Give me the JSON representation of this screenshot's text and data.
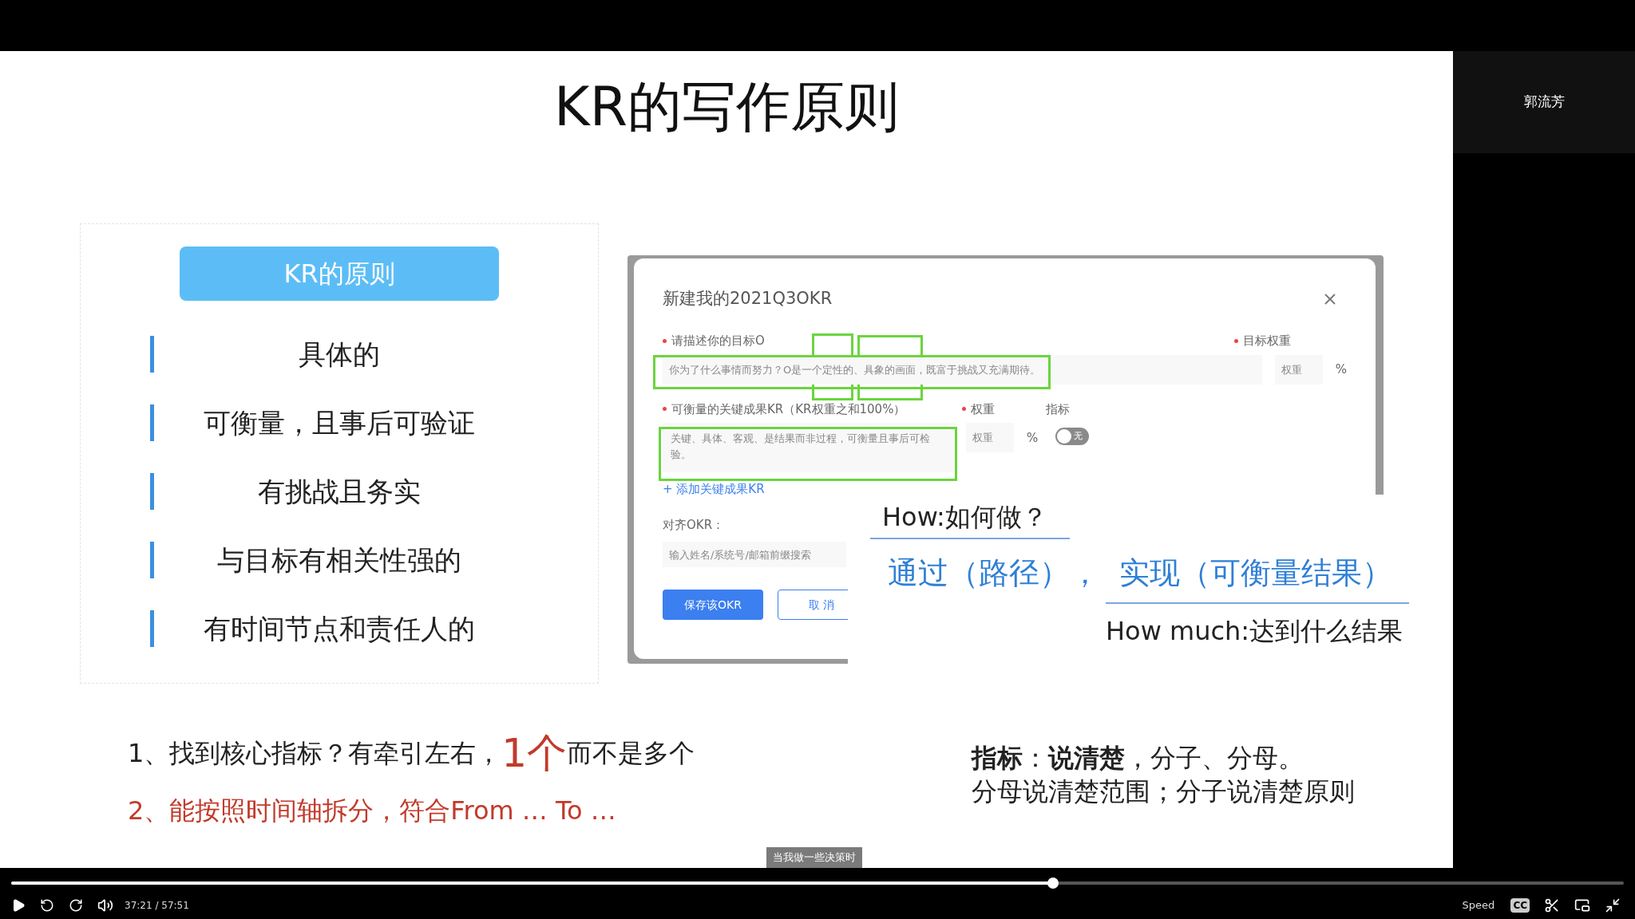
{
  "slide": {
    "title": "KR的写作原则",
    "card": {
      "header": "KR的原则",
      "items": [
        "具体的",
        "可衡量，且事后可验证",
        "有挑战且务实",
        "与目标有相关性强的",
        "有时间节点和责任人的"
      ]
    },
    "dialog": {
      "title": "新建我的2021Q3OKR",
      "objective_label": "请描述你的目标O",
      "objective_placeholder": "你为了什么事情而努力？O是一个定性的、具象的画面，既富于挑战又充满期待。",
      "weight_label": "目标权重",
      "weight_placeholder": "权重",
      "percent": "%",
      "kr_label": "可衡量的关键成果KR（KR权重之和100%）",
      "kr_weight_label": "权重",
      "kr_metric_label": "指标",
      "kr_placeholder": "关键、具体、客观、是结果而非过程，可衡量且事后可检验。",
      "kr_weight_placeholder": "权重",
      "kr_percent": "%",
      "toggle": {
        "label": "无",
        "on": false
      },
      "add_link": "+ 添加关键成果KR",
      "align_label": "对齐OKR：",
      "align_placeholder": "输入姓名/系统号/邮箱前缀搜索",
      "save_button": "保存该OKR",
      "cancel_button": "取 消"
    },
    "overlay": {
      "how": "How:如何做？",
      "formula": "通过（路径），  实现（可衡量结果）",
      "how_much": "How much:达到什么结果"
    },
    "notes_left": [
      {
        "parts": [
          {
            "kind": "plain",
            "text": "1、找到核心指标？有牵引左右，"
          },
          {
            "kind": "emphasis",
            "text": "1个"
          },
          {
            "kind": "plain",
            "text": "而不是多个"
          }
        ]
      },
      {
        "parts": [
          {
            "kind": "red",
            "text": "2、能按照时间轴拆分，符合From … To …"
          }
        ]
      }
    ],
    "notes_right": [
      "**指标**：**说清楚**，分子、分母。",
      "分母说清楚范围；分子说清楚原则"
    ]
  },
  "speaker": {
    "name": "郭流芳"
  },
  "tooltip": "当我做一些决策时",
  "player": {
    "playing": false,
    "level": 0.646,
    "time": "37:21 / 57:51",
    "speed": "Speed",
    "cc": "CC"
  }
}
